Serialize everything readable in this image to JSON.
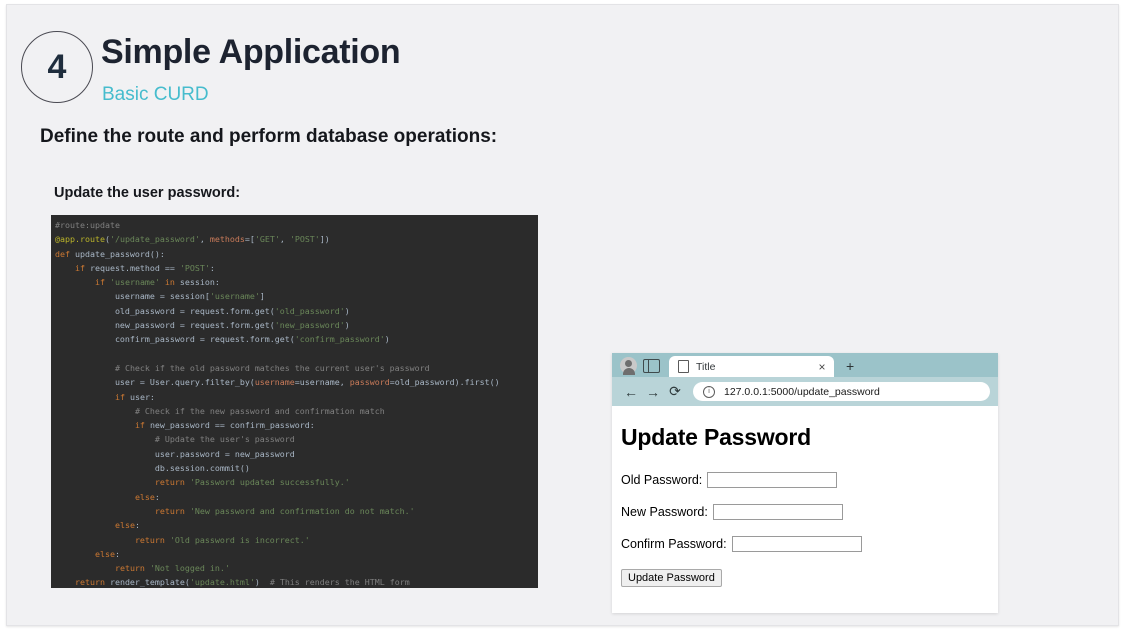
{
  "slide": {
    "badge_number": "4",
    "title": "Simple Application",
    "subtitle": "Basic CURD",
    "lead": "Define the route and perform database operations:",
    "subhead": "Update the user password:",
    "accent_color": "#46bccd",
    "frame_bg": "#f1f1f3"
  },
  "code": {
    "background": "#2b2b2b",
    "language": "python",
    "lines": [
      "#route:update",
      "@app.route('/update_password', methods=['GET', 'POST'])",
      "def update_password():",
      "    if request.method == 'POST':",
      "        if 'username' in session:",
      "            username = session['username']",
      "            old_password = request.form.get('old_password')",
      "            new_password = request.form.get('new_password')",
      "            confirm_password = request.form.get('confirm_password')",
      "",
      "            # Check if the old password matches the current user's password",
      "            user = User.query.filter_by(username=username, password=old_password).first()",
      "            if user:",
      "                # Check if the new password and confirmation match",
      "                if new_password == confirm_password:",
      "                    # Update the user's password",
      "                    user.password = new_password",
      "                    db.session.commit()",
      "                    return 'Password updated successfully.'",
      "                else:",
      "                    return 'New password and confirmation do not match.'",
      "            else:",
      "                return 'Old password is incorrect.'",
      "        else:",
      "            return 'Not logged in.'",
      "    return render_template('update.html')  # This renders the HTML form"
    ]
  },
  "browser": {
    "tab": {
      "title": "Title",
      "close_label": "×",
      "new_tab_label": "+"
    },
    "toolbar": {
      "back_label": "←",
      "forward_label": "→",
      "reload_label": "⟳",
      "info_label": "i",
      "url": "127.0.0.1:5000/update_password"
    },
    "page": {
      "heading": "Update Password",
      "fields": [
        {
          "label": "Old Password:",
          "value": "",
          "placeholder": ""
        },
        {
          "label": "New Password:",
          "value": "",
          "placeholder": ""
        },
        {
          "label": "Confirm Password:",
          "value": "",
          "placeholder": ""
        }
      ],
      "submit_label": "Update Password"
    },
    "tabstrip_color": "#9bc3c9",
    "navbar_color": "#b9d4d8"
  }
}
